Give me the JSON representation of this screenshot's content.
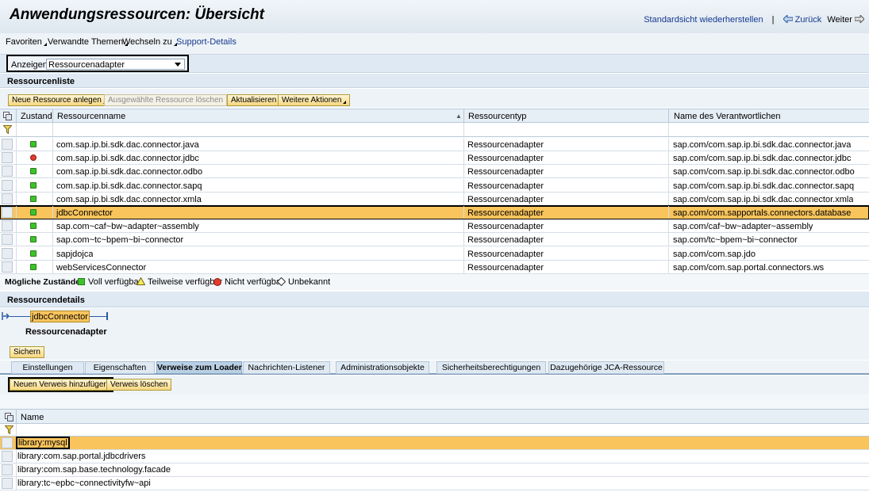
{
  "header": {
    "title": "Anwendungsressourcen: Übersicht",
    "restore": "Standardsicht wiederherstellen",
    "separator": "|",
    "back": "Zurück",
    "forward": "Weiter"
  },
  "menu": {
    "favorites": "Favoriten",
    "related": "Verwandte Themen",
    "switch": "Wechseln zu",
    "support": "Support-Details"
  },
  "show": {
    "label": "Anzeigen:",
    "value": "Ressourcenadapter"
  },
  "resource_list": {
    "title": "Ressourcenliste",
    "buttons": {
      "new": "Neue Ressource anlegen",
      "delete": "Ausgewählte Ressource löschen",
      "refresh": "Aktualisieren",
      "more": "Weitere Aktionen"
    },
    "columns": {
      "state": "Zustand",
      "name": "Ressourcenname",
      "type": "Ressourcentyp",
      "owner": "Name des Verantwortlichen"
    },
    "rows": [
      {
        "status": "green",
        "name": "com.sap.ip.bi.sdk.dac.connector.java",
        "type": "Ressourcenadapter",
        "owner": "sap.com/com.sap.ip.bi.sdk.dac.connector.java"
      },
      {
        "status": "red",
        "name": "com.sap.ip.bi.sdk.dac.connector.jdbc",
        "type": "Ressourcenadapter",
        "owner": "sap.com/com.sap.ip.bi.sdk.dac.connector.jdbc"
      },
      {
        "status": "green",
        "name": "com.sap.ip.bi.sdk.dac.connector.odbo",
        "type": "Ressourcenadapter",
        "owner": "sap.com/com.sap.ip.bi.sdk.dac.connector.odbo"
      },
      {
        "status": "green",
        "name": "com.sap.ip.bi.sdk.dac.connector.sapq",
        "type": "Ressourcenadapter",
        "owner": "sap.com/com.sap.ip.bi.sdk.dac.connector.sapq"
      },
      {
        "status": "green",
        "name": "com.sap.ip.bi.sdk.dac.connector.xmla",
        "type": "Ressourcenadapter",
        "owner": "sap.com/com.sap.ip.bi.sdk.dac.connector.xmla"
      },
      {
        "status": "green",
        "name": "jdbcConnector",
        "type": "Ressourcenadapter",
        "owner": "sap.com/com.sapportals.connectors.database"
      },
      {
        "status": "green",
        "name": "sap.com~caf~bw~adapter~assembly",
        "type": "Ressourcenadapter",
        "owner": "sap.com/caf~bw~adapter~assembly"
      },
      {
        "status": "green",
        "name": "sap.com~tc~bpem~bi~connector",
        "type": "Ressourcenadapter",
        "owner": "sap.com/tc~bpem~bi~connector"
      },
      {
        "status": "green",
        "name": "sapjdojca",
        "type": "Ressourcenadapter",
        "owner": "sap.com/com.sap.jdo"
      },
      {
        "status": "green",
        "name": "webServicesConnector",
        "type": "Ressourcenadapter",
        "owner": "sap.com/com.sap.portal.connectors.ws"
      }
    ]
  },
  "legend": {
    "label": "Mögliche Zustände:",
    "full": "Voll verfügbar",
    "partial": "Teilweise verfügbar",
    "none": "Nicht verfügbar",
    "unknown": "Unbekannt"
  },
  "details": {
    "title": "Ressourcendetails",
    "node": "jdbcConnector",
    "subtitle": "Ressourcenadapter",
    "save": "Sichern"
  },
  "tabs": [
    "Einstellungen",
    "Eigenschaften",
    "Verweise zum Loader",
    "Nachrichten-Listener",
    "Administrationsobjekte",
    "Sicherheitsberechtigungen",
    "Dazugehörige JCA-Ressource"
  ],
  "refs": {
    "add": "Neuen Verweis hinzufügen",
    "delete": "Verweis löschen",
    "column": "Name",
    "rows": [
      "library:mysql",
      "library:com.sap.portal.jdbcdrivers",
      "library:com.sap.base.technology.facade",
      "library:tc~epbc~connectivityfw~api"
    ]
  },
  "colors": {
    "selected": "#f9c45c",
    "available": "#3cc32a",
    "unavailable": "#e23b2b",
    "button": "#f7d780"
  }
}
